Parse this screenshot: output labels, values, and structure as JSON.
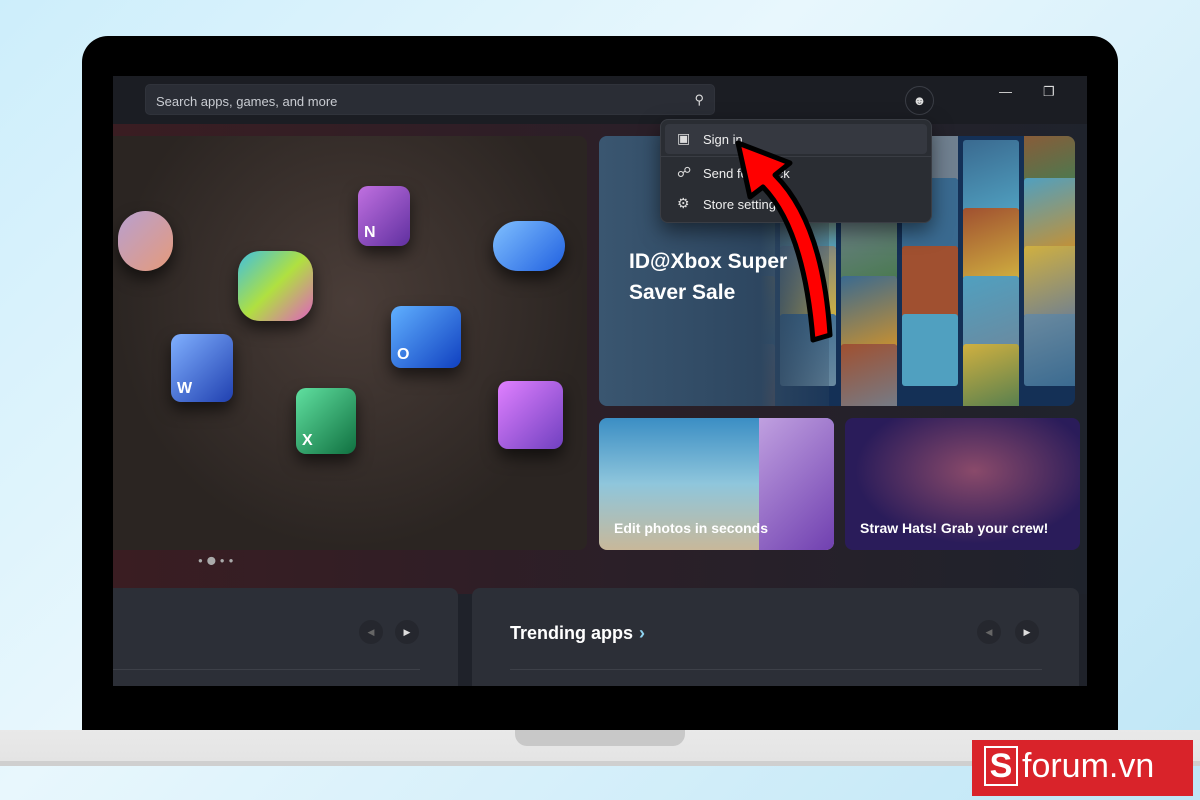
{
  "search": {
    "placeholder": "Search apps, games, and more",
    "icon": "search-icon"
  },
  "account_menu": {
    "items": [
      {
        "label": "Sign in",
        "icon": "badge-icon"
      },
      {
        "label": "Send feedback",
        "visible": "Send fee",
        "icon": "feedback-icon"
      },
      {
        "label": "Store settings",
        "visible": "Store setti",
        "icon": "gear-icon"
      }
    ]
  },
  "hero": {
    "carousel_pages": 4,
    "active_page": 2
  },
  "promo": {
    "title": "ID@Xbox Super Saver Sale"
  },
  "cards": [
    {
      "label": "Edit photos in seconds"
    },
    {
      "label": "Straw Hats! Grab your crew!"
    }
  ],
  "sections": [
    {
      "title": ""
    },
    {
      "title": "Trending apps"
    }
  ],
  "watermark": {
    "text": "forum.vn",
    "mark": "S"
  },
  "colors": {
    "annotation_arrow": "#ff0000",
    "brand_red": "#d9232a"
  }
}
